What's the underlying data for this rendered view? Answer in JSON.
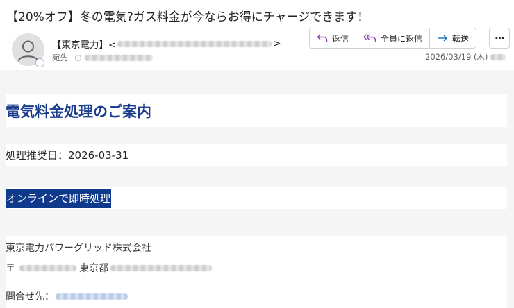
{
  "email": {
    "subject": "【20%オフ】冬の電気?ガス料金が今ならお得にチャージできます！",
    "sender_name": "【東京電力】<",
    "sender_close": ">",
    "to_label": "宛先",
    "date": "2026/03/19 (木)"
  },
  "toolbar": {
    "reply_label": "返信",
    "reply_all_label": "全員に返信",
    "forward_label": "転送",
    "more_label": "···"
  },
  "message": {
    "heading": "電気料金処理のご案内",
    "due_date_line": "処理推奨日：2026-03-31",
    "cta_label": "オンラインで即時処理",
    "company": "東京電力パワーグリッド株式会社",
    "postal_mark": "〒",
    "prefecture": "東京都",
    "contact_label": "問合せ先："
  },
  "colors": {
    "heading": "#1a3c8c",
    "cta_background": "#0f3a8c",
    "reply_icon": "#8a3fb5",
    "forward_icon": "#1f6fc4"
  }
}
